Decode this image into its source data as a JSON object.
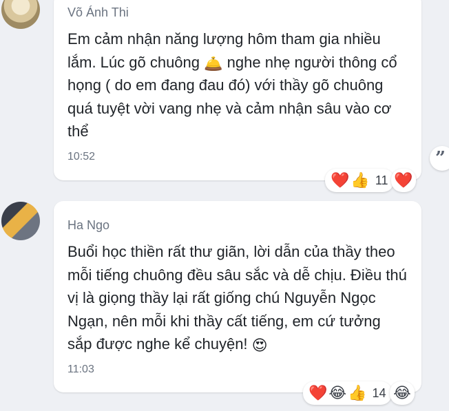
{
  "messages": [
    {
      "author": "Võ Ánh Thi",
      "text_part1": "Em cảm nhận năng lượng hôm tham gia nhiều lắm. Lúc gõ chuông ",
      "inline_emoji": "🛎️",
      "text_part2": " nghe nhẹ người thông cổ họng ( do em đang đau đó) với thầy gõ chuông quá tuyệt vời vang nhẹ và cảm nhận sâu vào cơ thể",
      "time": "10:52",
      "reactions": {
        "emojis": [
          "❤️",
          "👍"
        ],
        "count": "11",
        "extra": "❤️"
      }
    },
    {
      "author": "Ha Ngo",
      "text_part1": "Buổi học thiền rất thư giãn, lời dẫn của thầy theo mỗi tiếng chuông đều sâu sắc và dễ chịu. Điều thú vị là giọng thầy lại rất giống chú Nguyễn Ngọc Ngạn, nên mỗi khi thầy cất tiếng, em cứ tưởng sắp được nghe kể chuyện! ",
      "inline_emoji": "😍",
      "time": "11:03",
      "reactions": {
        "emojis": [
          "❤️",
          "😂",
          "👍"
        ],
        "count": "14",
        "extra": "😂"
      }
    }
  ],
  "quote_button": "”"
}
